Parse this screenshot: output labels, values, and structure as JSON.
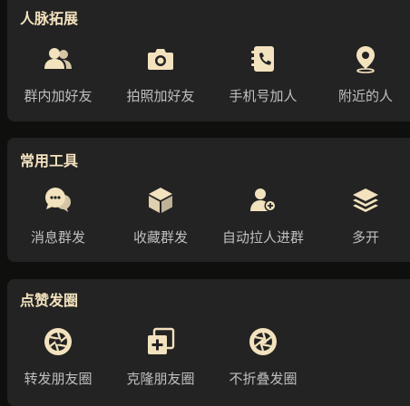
{
  "sections": [
    {
      "title": "人脉拓展",
      "items": [
        {
          "label": "群内加好友",
          "icon": "group-users-icon"
        },
        {
          "label": "拍照加好友",
          "icon": "camera-icon"
        },
        {
          "label": "手机号加人",
          "icon": "phone-contact-icon"
        },
        {
          "label": "附近的人",
          "icon": "location-pin-icon"
        }
      ]
    },
    {
      "title": "常用工具",
      "items": [
        {
          "label": "消息群发",
          "icon": "chat-bubbles-icon"
        },
        {
          "label": "收藏群发",
          "icon": "cube-icon"
        },
        {
          "label": "自动拉人进群",
          "icon": "add-user-icon"
        },
        {
          "label": "多开",
          "icon": "layers-icon"
        }
      ]
    },
    {
      "title": "点赞发圈",
      "items": [
        {
          "label": "转发朋友圈",
          "icon": "aperture-icon"
        },
        {
          "label": "克隆朋友圈",
          "icon": "clone-plus-icon"
        },
        {
          "label": "不折叠发圈",
          "icon": "aperture-up-icon"
        }
      ]
    }
  ],
  "colors": {
    "background": "#0f0f0e",
    "card": "#232323",
    "accent": "#f3e2be",
    "label": "#bfbfbf"
  }
}
